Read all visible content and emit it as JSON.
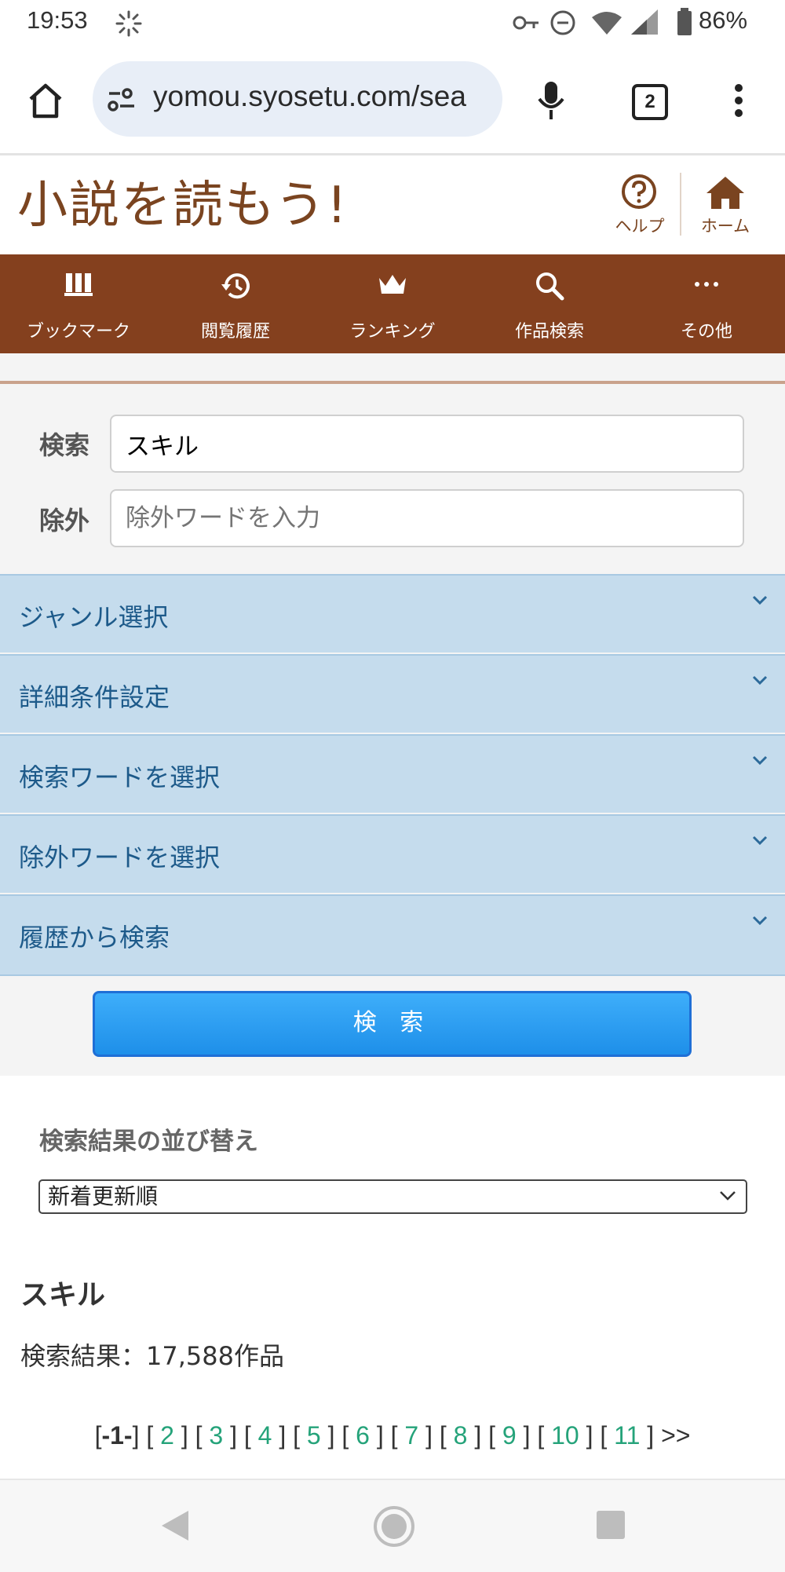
{
  "status_bar": {
    "time": "19:53",
    "battery": "86%"
  },
  "browser": {
    "url": "yomou.syosetu.com/sea",
    "tab_count": "2"
  },
  "site": {
    "logo": "小説を読もう!",
    "help_label": "ヘルプ",
    "home_label": "ホーム"
  },
  "nav": {
    "bookmark": "ブックマーク",
    "history": "閲覧履歴",
    "ranking": "ランキング",
    "search": "作品検索",
    "other": "その他"
  },
  "form": {
    "search_label": "検索",
    "search_value": "スキル",
    "exclude_label": "除外",
    "exclude_placeholder": "除外ワードを入力",
    "accordions": [
      "ジャンル選択",
      "詳細条件設定",
      "検索ワードを選択",
      "除外ワードを選択",
      "履歴から検索"
    ],
    "submit_label": "検 索"
  },
  "results": {
    "sort_heading": "検索結果の並び替え",
    "sort_selected": "新着更新順",
    "title": "スキル",
    "count": "検索結果：17,588作品"
  },
  "pagination": {
    "current": "-1-",
    "pages": [
      "2",
      "3",
      "4",
      "5",
      "6",
      "7",
      "8",
      "9",
      "10",
      "11"
    ],
    "next": ">>"
  }
}
